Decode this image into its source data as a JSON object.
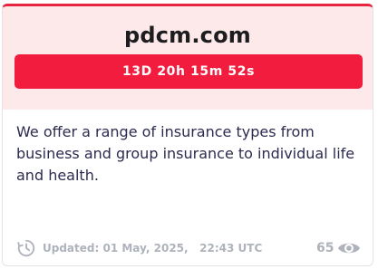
{
  "card": {
    "domain": "pdcm.com",
    "countdown": "13D 20h 15m 52s",
    "description": "We offer a range of insurance types from business and group insurance to individual life and health.",
    "updated_label": "Updated: 01 May, 2025,",
    "updated_time": "22:43 UTC",
    "views": "65"
  },
  "icons": {
    "clock": "clock-history-icon",
    "eye": "eye-icon"
  },
  "colors": {
    "accent": "#f21c3f",
    "header_bg": "#fde9ea",
    "muted": "#aeb3bb",
    "text": "#2b2b4f"
  }
}
